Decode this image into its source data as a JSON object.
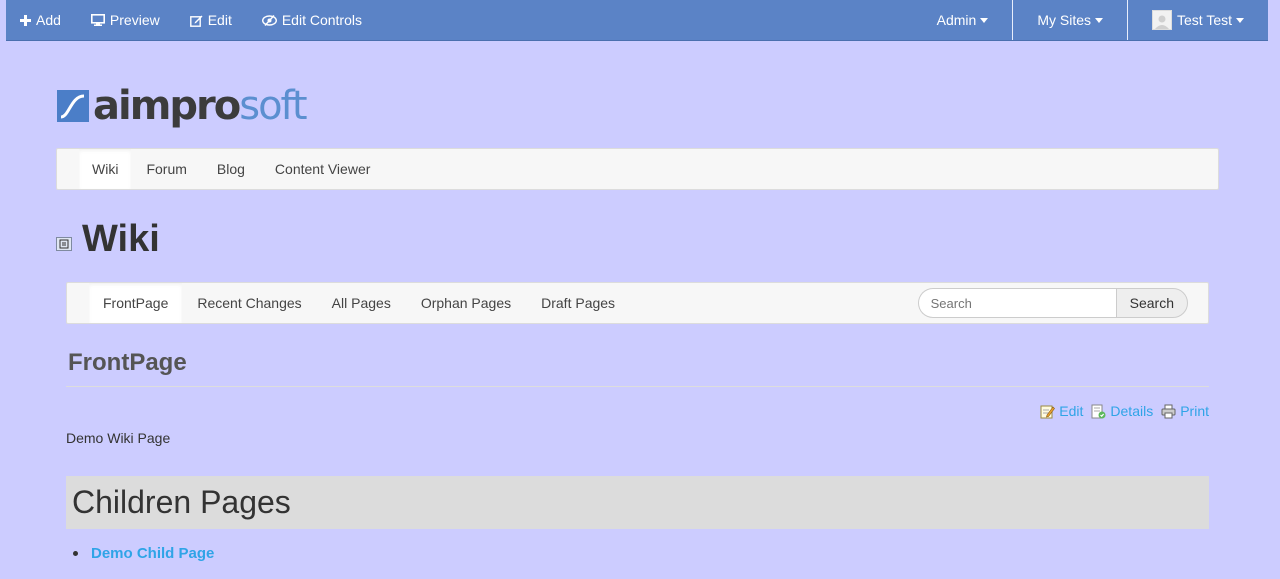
{
  "dockbar": {
    "add_label": "Add",
    "preview_label": "Preview",
    "edit_label": "Edit",
    "edit_controls_label": "Edit Controls",
    "admin_label": "Admin",
    "my_sites_label": "My Sites",
    "user_label": "Test Test",
    "bar_color": "#5b83c6"
  },
  "logo": {
    "part1": "aimpro",
    "part2": "soft"
  },
  "main_nav": {
    "items": [
      {
        "label": "Wiki",
        "active": true
      },
      {
        "label": "Forum"
      },
      {
        "label": "Blog"
      },
      {
        "label": "Content Viewer"
      }
    ]
  },
  "portlet": {
    "title": "Wiki"
  },
  "wiki_nav": {
    "items": [
      {
        "label": "FrontPage",
        "active": true
      },
      {
        "label": "Recent Changes"
      },
      {
        "label": "All Pages"
      },
      {
        "label": "Orphan Pages"
      },
      {
        "label": "Draft Pages"
      }
    ],
    "search_placeholder": "Search",
    "search_button": "Search"
  },
  "page": {
    "title": "FrontPage",
    "actions": {
      "edit": "Edit",
      "details": "Details",
      "print": "Print"
    },
    "content": "Demo Wiki Page",
    "children_heading": "Children Pages",
    "children": [
      "Demo Child Page"
    ]
  },
  "colors": {
    "background": "#ccccff",
    "link": "#2fa4e7"
  }
}
